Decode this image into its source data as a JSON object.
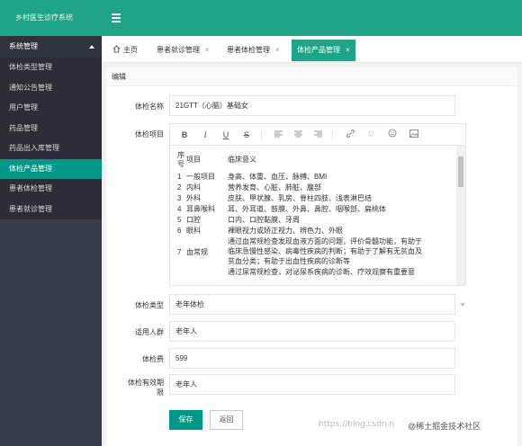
{
  "app": {
    "title": "乡村医生诊疗系统"
  },
  "sidebar": {
    "group_label": "系统管理",
    "items": [
      {
        "label": "体检类型管理"
      },
      {
        "label": "通知公告管理"
      },
      {
        "label": "用户管理"
      },
      {
        "label": "药品管理"
      },
      {
        "label": "药品出入库管理"
      },
      {
        "label": "体检产品管理",
        "active": true
      },
      {
        "label": "患者体检管理"
      },
      {
        "label": "患者就诊管理"
      }
    ]
  },
  "tabs": [
    {
      "label": "主页"
    },
    {
      "label": "患者就诊管理"
    },
    {
      "label": "患者体检管理"
    },
    {
      "label": "体检产品管理",
      "active": true
    }
  ],
  "tab_close": "×",
  "panel": {
    "title": "编辑"
  },
  "form": {
    "name": {
      "label": "体检名称",
      "value": "21GTT（心脑）基础女"
    },
    "items": {
      "label": "体检项目"
    },
    "type": {
      "label": "体检类型",
      "value": "老年体检"
    },
    "crowd": {
      "label": "适用人群",
      "value": "老年人"
    },
    "fee": {
      "label": "体检费",
      "value": "599"
    },
    "validity": {
      "label_line1": "体检有效期",
      "label_line2": "限",
      "value": "老年人"
    }
  },
  "editor": {
    "toolbar": [
      "B",
      "I",
      "U",
      "S"
    ],
    "toolbar_icons": [
      "align-left-icon",
      "align-center-icon",
      "align-right-icon",
      "link-icon",
      "unlink-icon",
      "emoji-icon",
      "image-icon"
    ],
    "table": {
      "header": {
        "no_line1": "序",
        "no_line2": "号",
        "item": "项目",
        "meaning": "临床意义"
      },
      "rows": [
        {
          "no": "1",
          "item": "一般项目",
          "meaning": "身高、体重、血压、脉搏、BMI"
        },
        {
          "no": "2",
          "item": "内科",
          "meaning": "营养发育、心脏、肺脏、腹部"
        },
        {
          "no": "3",
          "item": "外科",
          "meaning": "皮肤、甲状腺、乳房、脊柱四肢、浅表淋巴结"
        },
        {
          "no": "4",
          "item": "耳鼻喉科",
          "meaning": "耳、外耳道、鼓膜、外鼻、鼻腔、咽喉部、扁桃体"
        },
        {
          "no": "5",
          "item": "口腔",
          "meaning": "口内、口腔黏膜、牙周"
        },
        {
          "no": "6",
          "item": "眼科",
          "meaning": "裸眼视力或矫正视力、辨色力、外眼"
        },
        {
          "no": "7",
          "item": "血常规",
          "meaning_lines": [
            "通过血常规检查发现血液方面的问题，评价骨髓功能，有助于",
            "临床急慢性感染、病毒性疾病的判断；有助于了解有无贫血及",
            "贫血分类；有助于出血性疾病的诊断等"
          ]
        },
        {
          "no": "",
          "item": "",
          "meaning": "通过尿常规检查，对泌尿系疾病的诊断、疗效观察有重要意"
        }
      ]
    }
  },
  "buttons": {
    "save": "保存",
    "back": "返回"
  },
  "watermark": {
    "url": "https://blog.csdn.n",
    "site": "@稀土掘金技术社区"
  },
  "colors": {
    "primary": "#20a487",
    "sidebar": "#393d49",
    "active": "#009688"
  }
}
